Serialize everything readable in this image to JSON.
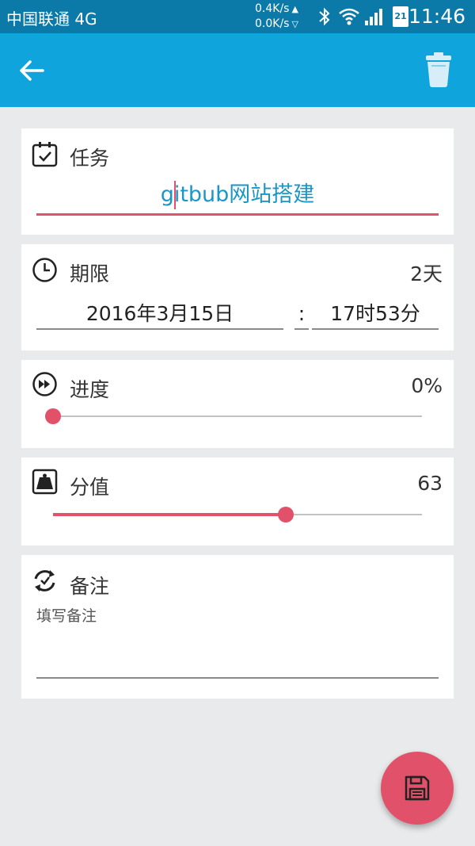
{
  "status_bar": {
    "carrier": "中国联通 4G",
    "speed_up": "0.4K/s",
    "speed_down": "0.0K/s",
    "battery_level": "21",
    "time": "11:46"
  },
  "app_bar": {
    "back_icon": "arrow-left-icon",
    "delete_icon": "trash-icon"
  },
  "task": {
    "title": "任务",
    "value": "gitbub网站搭建"
  },
  "deadline": {
    "title": "期限",
    "remaining": "2天",
    "date": "2016年3月15日",
    "separator": ":",
    "time": "17时53分"
  },
  "progress": {
    "title": "进度",
    "value_text": "0%",
    "value": 0
  },
  "score": {
    "title": "分值",
    "value_text": "63",
    "fraction": 0.63
  },
  "notes": {
    "title": "备注",
    "placeholder": "填写备注"
  },
  "fab": {
    "icon": "save-icon"
  },
  "colors": {
    "status_bar": "#0b7aa8",
    "app_bar": "#10a4dc",
    "accent": "#e2516a",
    "task_text": "#1a96c8",
    "background": "#e8eaeb"
  }
}
